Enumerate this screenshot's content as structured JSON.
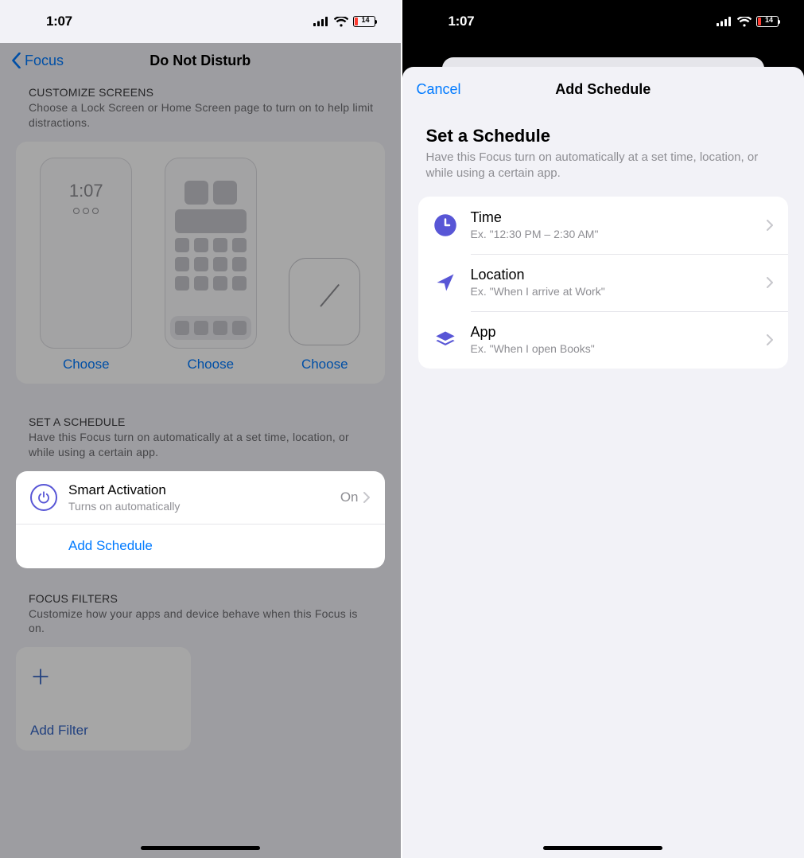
{
  "status": {
    "time": "1:07",
    "battery_value": "14"
  },
  "left": {
    "back_label": "Focus",
    "title": "Do Not Disturb",
    "customize": {
      "heading": "CUSTOMIZE SCREENS",
      "desc": "Choose a Lock Screen or Home Screen page to turn on to help limit distractions.",
      "lock_time": "1:07",
      "choose": "Choose"
    },
    "schedule": {
      "heading": "SET A SCHEDULE",
      "desc": "Have this Focus turn on automatically at a set time, location, or while using a certain app.",
      "smart_title": "Smart Activation",
      "smart_sub": "Turns on automatically",
      "smart_value": "On",
      "add_schedule": "Add Schedule"
    },
    "filters": {
      "heading": "FOCUS FILTERS",
      "desc": "Customize how your apps and device behave when this Focus is on.",
      "add_filter": "Add Filter"
    }
  },
  "right": {
    "cancel": "Cancel",
    "title": "Add Schedule",
    "header": "Set a Schedule",
    "desc": "Have this Focus turn on automatically at a set time, location, or while using a certain app.",
    "options": [
      {
        "title": "Time",
        "sub": "Ex. \"12:30 PM – 2:30 AM\""
      },
      {
        "title": "Location",
        "sub": "Ex. \"When I arrive at Work\""
      },
      {
        "title": "App",
        "sub": "Ex. \"When I open Books\""
      }
    ]
  }
}
